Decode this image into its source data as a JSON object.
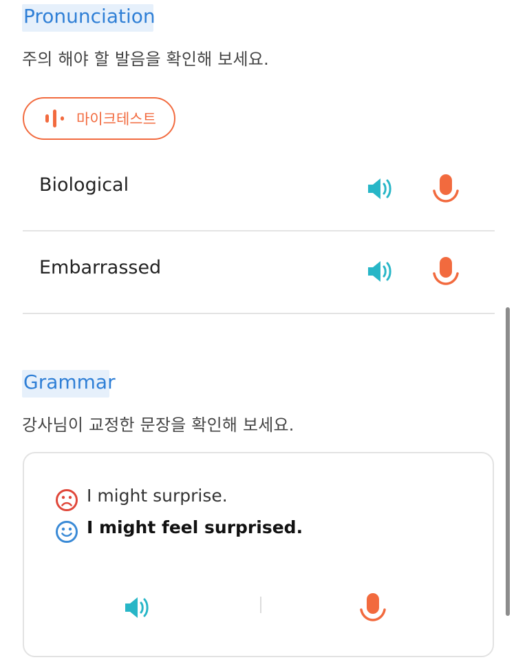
{
  "pronunciation": {
    "title": "Pronunciation",
    "subtitle": "주의 해야 할 발음을 확인해 보세요.",
    "mic_test_label": "마이크테스트",
    "words": [
      "Biological",
      "Embarrassed"
    ]
  },
  "grammar": {
    "title": "Grammar",
    "subtitle": "강사님이 교정한 문장을 확인해 보세요.",
    "original_sentence": "I might surprise.",
    "corrected_sentence": "I might feel surprised."
  },
  "icons": {
    "speaker": "speaker-icon",
    "mic": "microphone-icon",
    "sad": "sad-face-icon",
    "happy": "happy-face-icon",
    "waveform": "waveform-icon"
  },
  "colors": {
    "accent_blue": "#2f7fd6",
    "speaker_teal": "#27b6c7",
    "mic_orange": "#f26a3e",
    "sad_red": "#e0473a",
    "happy_blue": "#3a8ad6"
  }
}
